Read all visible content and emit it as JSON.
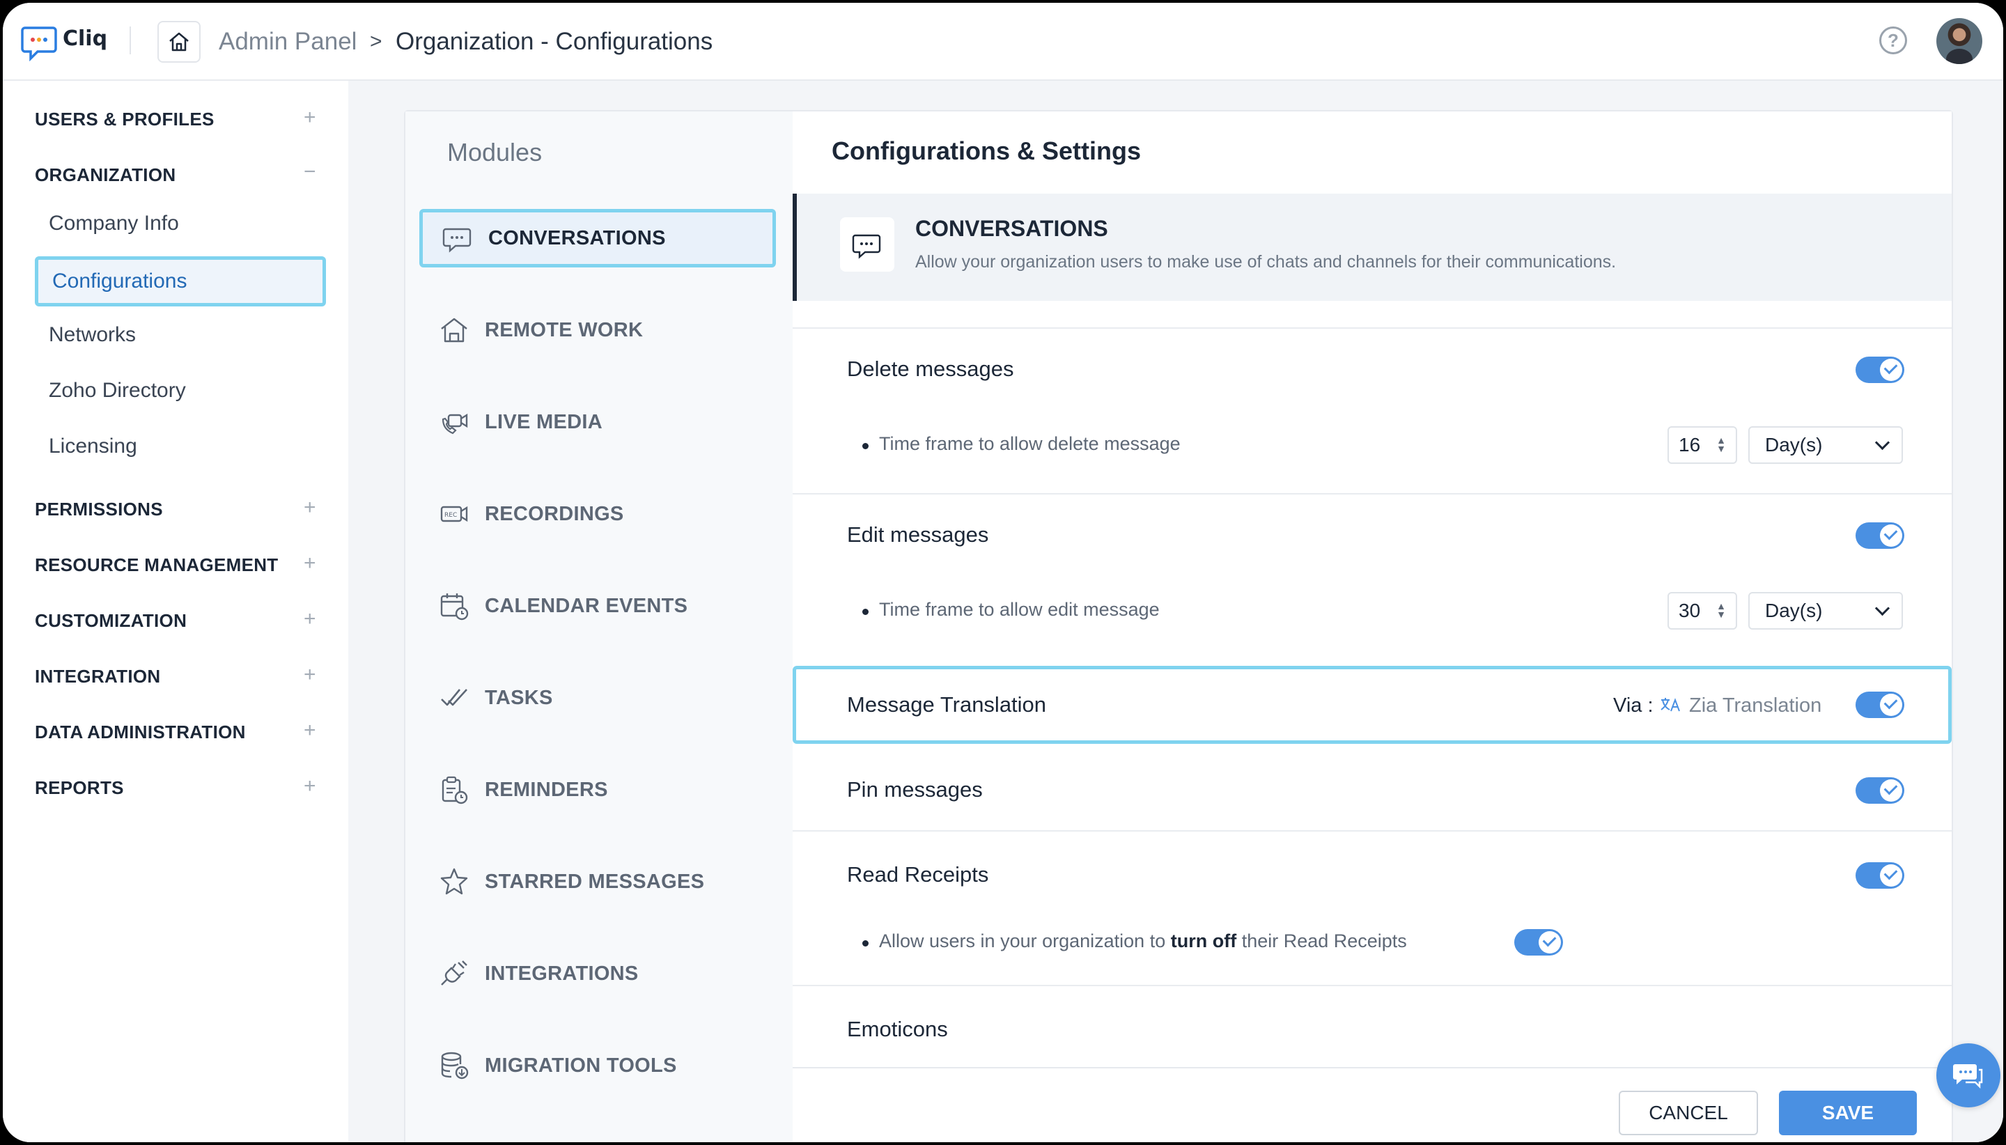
{
  "app": {
    "name": "Cliq"
  },
  "breadcrumb": {
    "root": "Admin Panel",
    "separator": ">",
    "current": "Organization - Configurations"
  },
  "sidebar": {
    "sections": [
      {
        "label": "USERS & PROFILES",
        "toggle": "+"
      },
      {
        "label": "ORGANIZATION",
        "toggle": "−"
      },
      {
        "label": "PERMISSIONS",
        "toggle": "+"
      },
      {
        "label": "RESOURCE MANAGEMENT",
        "toggle": "+"
      },
      {
        "label": "CUSTOMIZATION",
        "toggle": "+"
      },
      {
        "label": "INTEGRATION",
        "toggle": "+"
      },
      {
        "label": "DATA ADMINISTRATION",
        "toggle": "+"
      },
      {
        "label": "REPORTS",
        "toggle": "+"
      }
    ],
    "org_items": [
      "Company Info",
      "Configurations",
      "Networks",
      "Zoho Directory",
      "Licensing"
    ]
  },
  "modules": {
    "title": "Modules",
    "items": [
      "CONVERSATIONS",
      "REMOTE WORK",
      "LIVE MEDIA",
      "RECORDINGS",
      "CALENDAR EVENTS",
      "TASKS",
      "REMINDERS",
      "STARRED MESSAGES",
      "INTEGRATIONS",
      "MIGRATION TOOLS"
    ]
  },
  "settings": {
    "title": "Configurations & Settings",
    "section_title": "CONVERSATIONS",
    "section_desc": "Allow your organization users to make use of chats and channels for their communications.",
    "delete": {
      "label": "Delete messages",
      "sub": "Time frame to allow delete message",
      "value": "16",
      "unit": "Day(s)"
    },
    "edit": {
      "label": "Edit messages",
      "sub": "Time frame to allow edit message",
      "value": "30",
      "unit": "Day(s)"
    },
    "translation": {
      "label": "Message Translation",
      "via_label": "Via :",
      "via_value": "Zia Translation"
    },
    "pin": {
      "label": "Pin messages"
    },
    "read_receipts": {
      "label": "Read Receipts",
      "sub_pre": "Allow users in your organization to ",
      "sub_bold": "turn off",
      "sub_post": " their Read Receipts"
    },
    "emoticons": {
      "label": "Emoticons"
    }
  },
  "footer": {
    "cancel": "CANCEL",
    "save": "SAVE"
  },
  "colors": {
    "accent": "#4a90e2",
    "highlight": "#7fd3ef",
    "text": "#1c2737"
  }
}
